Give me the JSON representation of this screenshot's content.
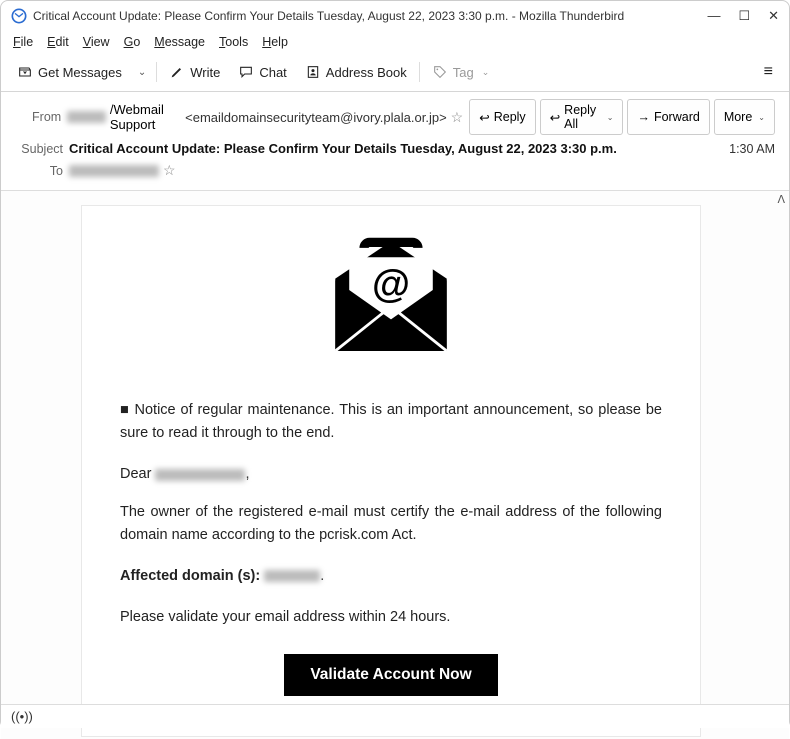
{
  "window": {
    "title": "Critical Account Update: Please Confirm Your Details Tuesday, August 22, 2023 3:30 p.m. - Mozilla Thunderbird"
  },
  "menu": {
    "file": "File",
    "edit": "Edit",
    "view": "View",
    "go": "Go",
    "message": "Message",
    "tools": "Tools",
    "help": "Help"
  },
  "toolbar": {
    "get_messages": "Get Messages",
    "write": "Write",
    "chat": "Chat",
    "address_book": "Address Book",
    "tag": "Tag"
  },
  "headers": {
    "from_label": "From",
    "from_name_suffix": "/Webmail Support",
    "from_addr": "<emaildomainsecurityteam@ivory.plala.or.jp>",
    "subject_label": "Subject",
    "subject": "Critical Account Update: Please Confirm Your Details Tuesday, August 22, 2023 3:30 p.m.",
    "to_label": "To",
    "time": "1:30 AM",
    "reply": "Reply",
    "reply_all": "Reply All",
    "forward": "Forward",
    "more": "More"
  },
  "body": {
    "notice": "■ Notice of regular maintenance. This is an important announcement, so please be sure to read it through to the end.",
    "dear_prefix": "Dear ",
    "dear_suffix": ",",
    "para2": "The owner of the registered e-mail must certify the e-mail address of the following domain name according to the pcrisk.com Act.",
    "affected_label": "Affected domain (s): ",
    "affected_suffix": ".",
    "para3": "Please validate your email address within 24 hours.",
    "cta": "Validate Account Now"
  }
}
